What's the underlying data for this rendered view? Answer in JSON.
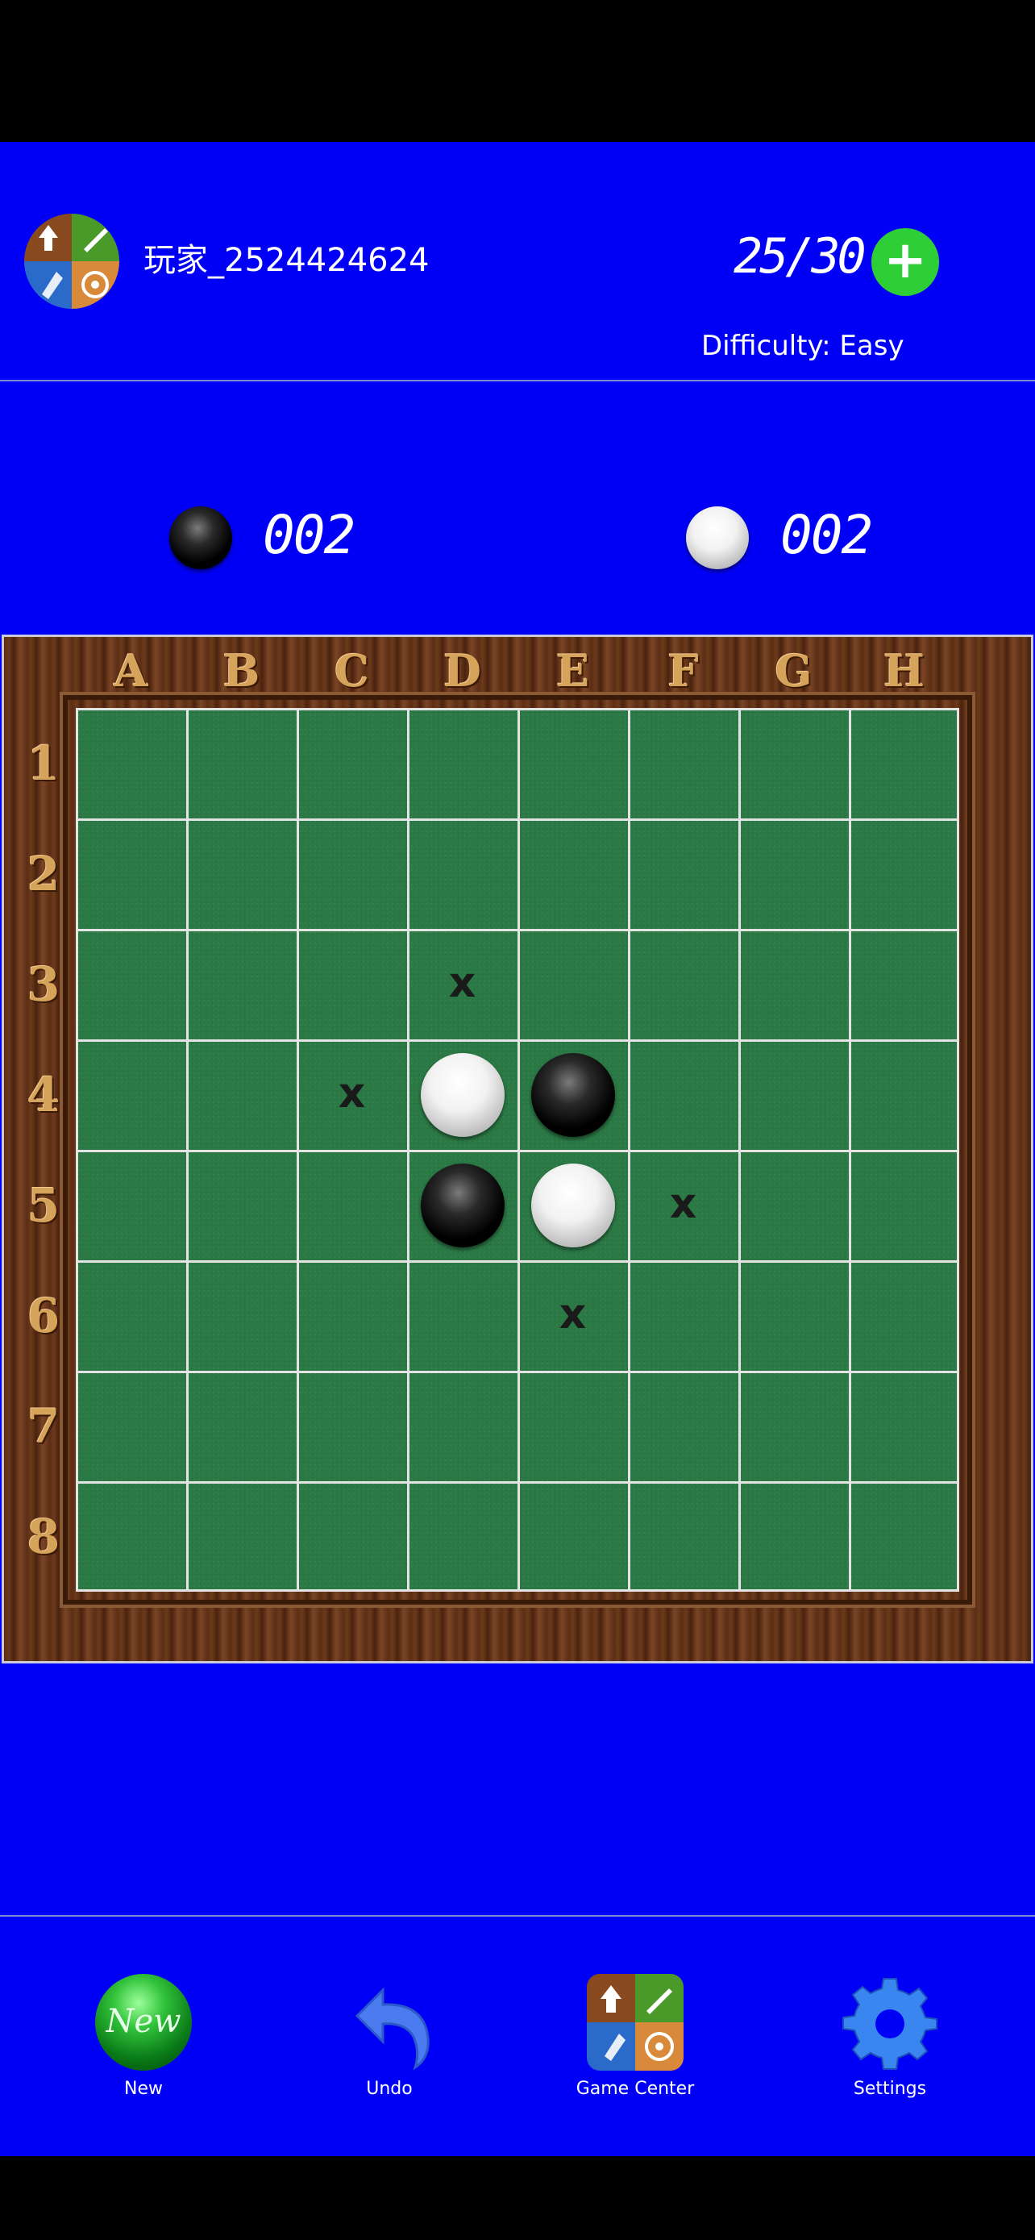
{
  "header": {
    "player_name": "玩家_2524424624",
    "moves": "25/30",
    "add_label": "+",
    "difficulty": "Difficulty: Easy"
  },
  "score": {
    "black_count": "002",
    "white_count": "002"
  },
  "board": {
    "columns": [
      "A",
      "B",
      "C",
      "D",
      "E",
      "F",
      "G",
      "H"
    ],
    "rows": [
      "1",
      "2",
      "3",
      "4",
      "5",
      "6",
      "7",
      "8"
    ],
    "discs": [
      {
        "cell": "D4",
        "color": "white"
      },
      {
        "cell": "E4",
        "color": "black"
      },
      {
        "cell": "D5",
        "color": "black"
      },
      {
        "cell": "E5",
        "color": "white"
      }
    ],
    "hints": [
      "D3",
      "C4",
      "F5",
      "E6"
    ],
    "hint_mark": "x"
  },
  "toolbar": {
    "new_label": "New",
    "new_icon_text": "New",
    "undo_label": "Undo",
    "game_center_label": "Game Center",
    "settings_label": "Settings"
  },
  "colors": {
    "background": "#0000f6",
    "plus_button": "#2ecf36",
    "felt": "#2b7a46"
  }
}
